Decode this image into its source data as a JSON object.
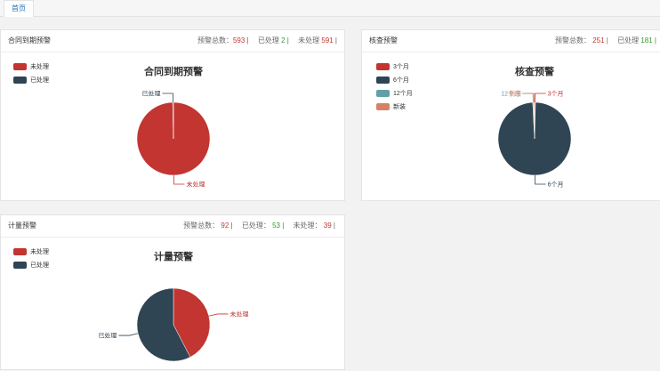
{
  "tabs": [
    {
      "label": "首页"
    }
  ],
  "colors": {
    "red": "#c23531",
    "dark": "#2f4554",
    "teal": "#61a0a8",
    "orange": "#d48265",
    "stat_red": "#c23531",
    "stat_green": "#2a9d2a"
  },
  "panels": {
    "contract": {
      "header": "合同到期预警",
      "stats": {
        "total_label": "预警总数：",
        "total_value": "593",
        "done_label": "已处理",
        "done_value": "2",
        "todo_label": "未处理",
        "todo_value": "591",
        "sep": "|"
      },
      "chart_title": "合同到期预警",
      "legend": [
        {
          "label": "未处理",
          "color": "#c23531"
        },
        {
          "label": "已处理",
          "color": "#2f4554"
        }
      ],
      "chart_data": {
        "type": "pie",
        "title": "合同到期预警",
        "slices": [
          {
            "name": "未处理",
            "value": 591,
            "color": "#c23531"
          },
          {
            "name": "已处理",
            "value": 2,
            "color": "#2f4554"
          }
        ]
      }
    },
    "inspection": {
      "header": "核查预警",
      "stats": {
        "total_label": "预警总数：",
        "total_value": "251",
        "done_label": "已处理",
        "done_value": "181",
        "sep": "|"
      },
      "chart_title": "核查预警",
      "legend": [
        {
          "label": "3个月",
          "color": "#c23531"
        },
        {
          "label": "6个月",
          "color": "#2f4554"
        },
        {
          "label": "12个月",
          "color": "#61a0a8"
        },
        {
          "label": "新装",
          "color": "#d48265"
        }
      ],
      "chart_data": {
        "type": "pie",
        "title": "核查预警",
        "slices": [
          {
            "name": "3个月",
            "value": 1,
            "color": "#c23531"
          },
          {
            "name": "6个月",
            "value": 248,
            "color": "#2f4554"
          },
          {
            "name": "12个月",
            "value": 1,
            "color": "#61a0a8"
          },
          {
            "name": "新装",
            "value": 1,
            "color": "#d48265"
          }
        ]
      }
    },
    "metering": {
      "header": "计量预警",
      "stats": {
        "total_label": "预警总数：",
        "total_value": "92",
        "done_label": "已处理：",
        "done_value": "53",
        "todo_label": "未处理：",
        "todo_value": "39",
        "sep": "|"
      },
      "chart_title": "计量预警",
      "legend": [
        {
          "label": "未处理",
          "color": "#c23531"
        },
        {
          "label": "已处理",
          "color": "#2f4554"
        }
      ],
      "chart_data": {
        "type": "pie",
        "title": "计量预警",
        "slices": [
          {
            "name": "未处理",
            "value": 39,
            "color": "#c23531"
          },
          {
            "name": "已处理",
            "value": 53,
            "color": "#2f4554"
          }
        ]
      }
    }
  }
}
